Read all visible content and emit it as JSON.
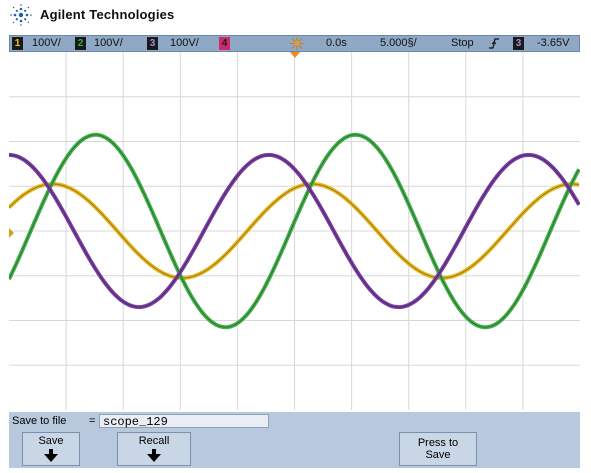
{
  "brand": {
    "name": "Agilent Technologies",
    "logo_icon": "agilent-spark-icon"
  },
  "status_bar": {
    "channels": [
      {
        "number": "1",
        "scale": "100V/",
        "color": "#e8c22a"
      },
      {
        "number": "2",
        "scale": "100V/",
        "color": "#3daa45"
      },
      {
        "number": "3",
        "scale": "100V/",
        "color": "#7a3fa0"
      },
      {
        "number": "4",
        "color": "#cc2a6a"
      }
    ],
    "time_offset": "0.0s",
    "time_scale": "5.000§/",
    "run_state": "Stop",
    "trigger_slope_icon": "rising-edge-icon",
    "trigger_channel": "3",
    "trigger_level": "-3.65V"
  },
  "waveforms": [
    {
      "channel": "1",
      "color": "#e8b820",
      "amplitude_divs": 1.05,
      "period_divs": 4.55,
      "phase_deg": 30
    },
    {
      "channel": "2",
      "color": "#44b04a",
      "amplitude_divs": 2.15,
      "period_divs": 4.55,
      "phase_deg": -30
    },
    {
      "channel": "3",
      "color": "#7b3fa3",
      "amplitude_divs": 1.7,
      "period_divs": 4.55,
      "phase_deg": 90
    }
  ],
  "softkey_panel": {
    "save_to_file_label": "Save to file",
    "filename": "scope_129",
    "keys": [
      {
        "label": "Save",
        "has_arrow": true
      },
      {
        "label": "Recall",
        "has_arrow": true
      },
      {
        "label": "Press to Save",
        "has_arrow": false
      }
    ]
  }
}
